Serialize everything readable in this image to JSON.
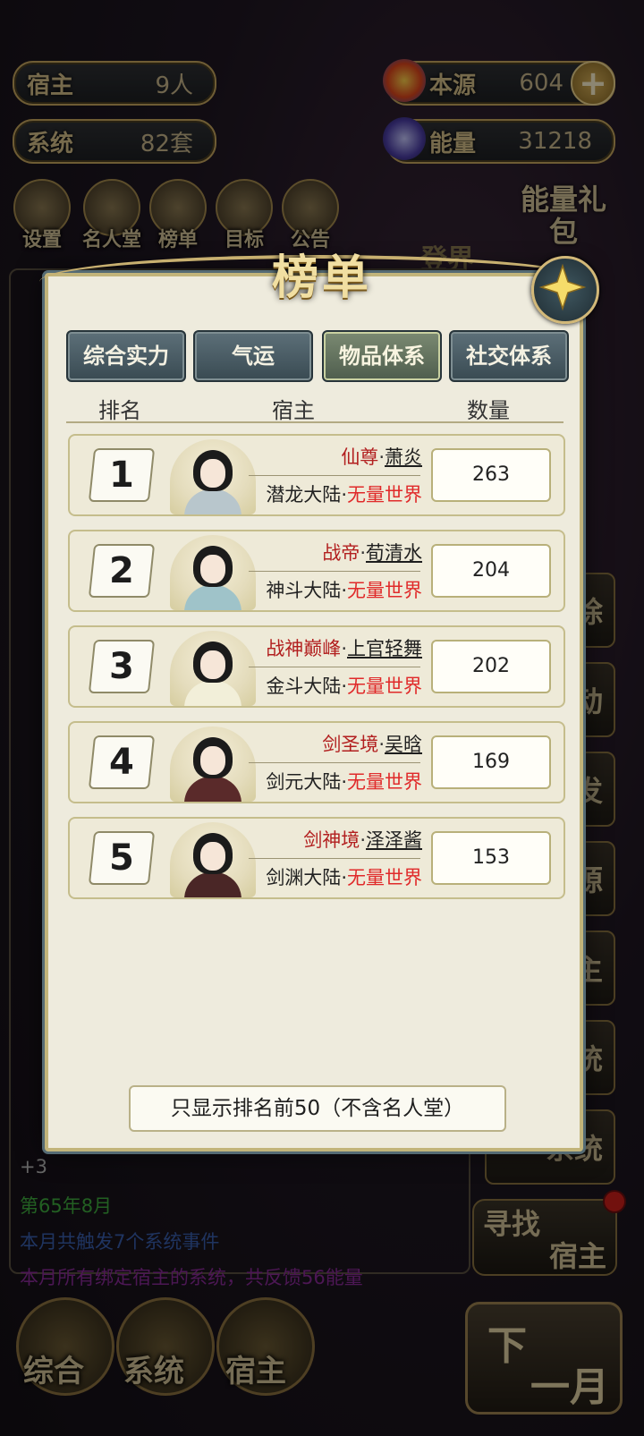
{
  "top": {
    "host_label": "宿主",
    "host_value": "9人",
    "system_label": "系统",
    "system_value": "82套",
    "source_label": "本源",
    "source_value": "604",
    "energy_label": "能量",
    "energy_value": "31218"
  },
  "nav": {
    "settings": "设置",
    "hall_of_fame": "名人堂",
    "leaderboard": "榜单",
    "goals": "目标",
    "notice": "公告",
    "energy_pack": "能量礼包",
    "realm": "登界"
  },
  "log": {
    "lines": [
      {
        "text": "第65年8月",
        "color": "#3fae3f"
      },
      {
        "text": "本月共触发7个系统事件",
        "color": "#3a5fb0"
      },
      {
        "text": "本月所有绑定宿主的系统，共反馈56能量",
        "color": "#8a2a9a"
      }
    ],
    "fragment": "+3"
  },
  "side_buttons": [
    "除",
    "动",
    "发",
    "源",
    "主",
    "统",
    "系统"
  ],
  "find_host": {
    "line1": "寻找",
    "line2": "宿主"
  },
  "bottom_nav": {
    "general": "综合",
    "system": "系统",
    "host": "宿主",
    "next_a": "下",
    "next_b": "一月"
  },
  "modal": {
    "title": "榜单",
    "tabs": [
      "综合实力",
      "气运",
      "物品体系",
      "社交体系"
    ],
    "active_tab": 2,
    "headers": {
      "rank": "排名",
      "host": "宿主",
      "qty": "数量"
    },
    "rows": [
      {
        "rank": "1",
        "title": "仙尊",
        "name": "萧炎",
        "continent": "潜龙大陆",
        "world": "无量世界",
        "qty": "263",
        "robe": "#b8c6cc"
      },
      {
        "rank": "2",
        "title": "战帝",
        "name": "荀清水",
        "continent": "神斗大陆",
        "world": "无量世界",
        "qty": "204",
        "robe": "#9fc3c9"
      },
      {
        "rank": "3",
        "title": "战神巅峰",
        "name": "上官轻舞",
        "continent": "金斗大陆",
        "world": "无量世界",
        "qty": "202",
        "robe": "#f2efd9"
      },
      {
        "rank": "4",
        "title": "剑圣境",
        "name": "吴晗",
        "continent": "剑元大陆",
        "world": "无量世界",
        "qty": "169",
        "robe": "#5a2a2a"
      },
      {
        "rank": "5",
        "title": "剑神境",
        "name": "泽泽酱",
        "continent": "剑渊大陆",
        "world": "无量世界",
        "qty": "153",
        "robe": "#4a2626"
      }
    ],
    "dot": "·",
    "footer": "只显示排名前50（不含名人堂）"
  }
}
